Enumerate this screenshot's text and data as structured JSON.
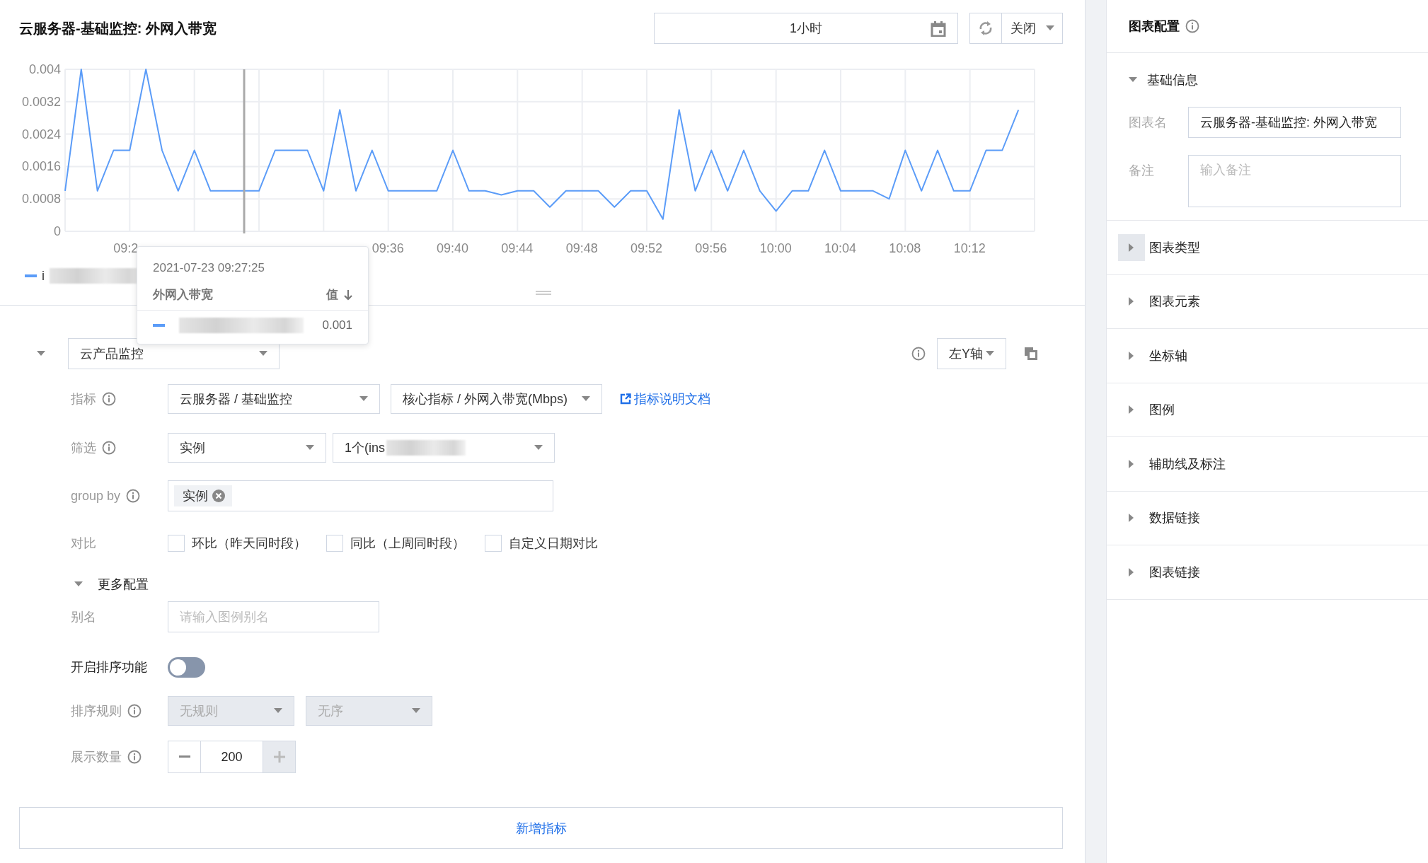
{
  "chart_panel": {
    "title": "云服务器-基础监控: 外网入带宽",
    "time_range": "1小时",
    "auto_refresh": "关闭",
    "chart_data": {
      "type": "line",
      "categories": [
        null,
        null,
        null,
        null,
        "09:2",
        null,
        null,
        null,
        null,
        null,
        null,
        null,
        null,
        null,
        null,
        null,
        null,
        null,
        null,
        null,
        "09:36",
        null,
        null,
        null,
        "09:40",
        null,
        null,
        null,
        "09:44",
        null,
        null,
        null,
        "09:48",
        null,
        null,
        null,
        "09:52",
        null,
        null,
        null,
        "09:56",
        null,
        null,
        null,
        "10:00",
        null,
        null,
        null,
        "10:04",
        null,
        null,
        null,
        "10:08",
        null,
        null,
        null,
        "10:12",
        null,
        null,
        null
      ],
      "grid": true,
      "series": [
        {
          "name": "i",
          "color": "#5b9cf8",
          "values": [
            0.001,
            0.004,
            0.001,
            0.002,
            0.002,
            0.004,
            0.002,
            0.001,
            0.002,
            0.001,
            0.001,
            0.001,
            0.001,
            0.002,
            0.002,
            0.002,
            0.001,
            0.003,
            0.001,
            0.002,
            0.001,
            0.001,
            0.001,
            0.001,
            0.002,
            0.001,
            0.001,
            0.0009,
            0.001,
            0.001,
            0.0006,
            0.001,
            0.001,
            0.001,
            0.0006,
            0.001,
            0.001,
            0.0003,
            0.003,
            0.001,
            0.002,
            0.001,
            0.002,
            0.001,
            0.0005,
            0.001,
            0.001,
            0.002,
            0.001,
            0.001,
            0.001,
            0.0008,
            0.002,
            0.001,
            0.002,
            0.001,
            0.001,
            0.002,
            0.002,
            0.003
          ]
        }
      ],
      "ylim": [
        0,
        0.004
      ],
      "yticks": [
        0,
        0.0008,
        0.0016,
        0.0024,
        0.0032,
        0.004
      ]
    },
    "tooltip": {
      "time": "2021-07-23 09:27:25",
      "metric": "外网入带宽",
      "value_header": "值",
      "rows": [
        {
          "color": "#5b9cf8",
          "value": "0.001"
        }
      ]
    }
  },
  "metric_config": {
    "expanded": true,
    "source": "云产品监控",
    "axis": "左Y轴",
    "metric": {
      "label": "指标",
      "product": "云服务器 / 基础监控",
      "metric": "核心指标 / 外网入带宽(Mbps)",
      "doc_link": "指标说明文档"
    },
    "filter": {
      "label": "筛选",
      "dimension": "实例",
      "instances": "1个(ins"
    },
    "group_by": {
      "label": "group by",
      "tags": [
        "实例"
      ]
    },
    "compare": {
      "label": "对比",
      "options": [
        {
          "label": "环比（昨天同时段）",
          "checked": false
        },
        {
          "label": "同比（上周同时段）",
          "checked": false
        },
        {
          "label": "自定义日期对比",
          "checked": false
        }
      ]
    },
    "more_config": {
      "label": "更多配置",
      "expanded": true
    },
    "alias": {
      "label": "别名",
      "placeholder": "请输入图例别名"
    },
    "sorting": {
      "label": "开启排序功能",
      "on": false
    },
    "sort_rule": {
      "label": "排序规则",
      "rule": "无规则",
      "order": "无序",
      "disabled": true
    },
    "display_count": {
      "label": "展示数量",
      "value": "200",
      "increment_disabled": true
    },
    "add_button": "新增指标"
  },
  "chart_settings": {
    "title": "图表配置",
    "basic_info": {
      "label": "基础信息",
      "expanded": true,
      "name_label": "图表名",
      "name_value": "云服务器-基础监控: 外网入带宽",
      "note_label": "备注",
      "note_placeholder": "输入备注"
    },
    "sections": [
      {
        "label": "图表类型",
        "expanded": false,
        "highlighted": true
      },
      {
        "label": "图表元素",
        "expanded": false,
        "highlighted": false
      },
      {
        "label": "坐标轴",
        "expanded": false,
        "highlighted": false
      },
      {
        "label": "图例",
        "expanded": false,
        "highlighted": false
      },
      {
        "label": "辅助线及标注",
        "expanded": false,
        "highlighted": false
      },
      {
        "label": "数据链接",
        "expanded": false,
        "highlighted": false
      },
      {
        "label": "图表链接",
        "expanded": false,
        "highlighted": false
      }
    ]
  }
}
